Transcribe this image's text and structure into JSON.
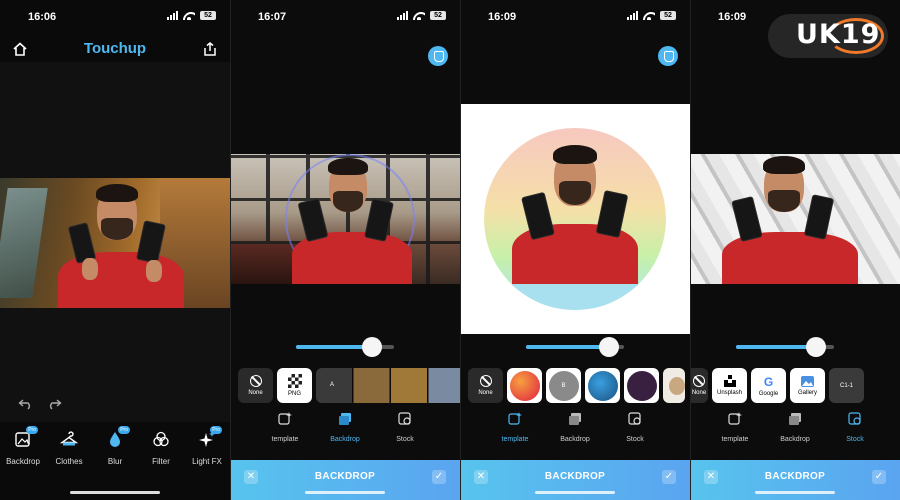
{
  "panels": [
    {
      "time": "16:06",
      "battery": "52",
      "title": "Touchup",
      "tools": [
        {
          "label": "Backdrop",
          "icon": "backdrop-icon",
          "badge": "Pro"
        },
        {
          "label": "Clothes",
          "icon": "hanger-icon",
          "badge": ""
        },
        {
          "label": "Blur",
          "icon": "droplet-icon",
          "badge": "Pro"
        },
        {
          "label": "Filter",
          "icon": "filter-icon",
          "badge": ""
        },
        {
          "label": "Light FX",
          "icon": "sparkle-icon",
          "badge": "Pro"
        }
      ]
    },
    {
      "time": "16:07",
      "battery": "52",
      "slider": 0.78,
      "thumbs": [
        {
          "label": "None",
          "kind": "none"
        },
        {
          "label": "PNG",
          "kind": "png"
        },
        {
          "label": "A",
          "kind": "image"
        }
      ],
      "tabs": [
        {
          "label": "template",
          "active": false
        },
        {
          "label": "Backdrop",
          "active": true
        },
        {
          "label": "Stock",
          "active": false
        }
      ],
      "bar_title": "BACKDROP"
    },
    {
      "time": "16:09",
      "battery": "52",
      "slider": 0.85,
      "thumbs": [
        {
          "label": "None",
          "kind": "none"
        },
        {
          "label": "B",
          "kind": "image"
        }
      ],
      "tabs": [
        {
          "label": "template",
          "active": true
        },
        {
          "label": "Backdrop",
          "active": false
        },
        {
          "label": "Stock",
          "active": false
        }
      ],
      "bar_title": "BACKDROP"
    },
    {
      "time": "16:09",
      "slider": 0.82,
      "thumbs": [
        {
          "label": "None",
          "kind": "none"
        },
        {
          "label": "Unsplash",
          "kind": "source"
        },
        {
          "label": "Google",
          "kind": "source"
        },
        {
          "label": "Gallery",
          "kind": "source"
        },
        {
          "label": "C1-1",
          "kind": "image"
        }
      ],
      "tabs": [
        {
          "label": "template",
          "active": false
        },
        {
          "label": "Backdrop",
          "active": false
        },
        {
          "label": "Stock",
          "active": true
        }
      ],
      "bar_title": "BACKDROP"
    }
  ],
  "watermark": {
    "text": "UK19"
  },
  "colors": {
    "accent": "#4fb8f0",
    "bar_start": "#57c4ee",
    "bar_end": "#5aa4f0"
  }
}
